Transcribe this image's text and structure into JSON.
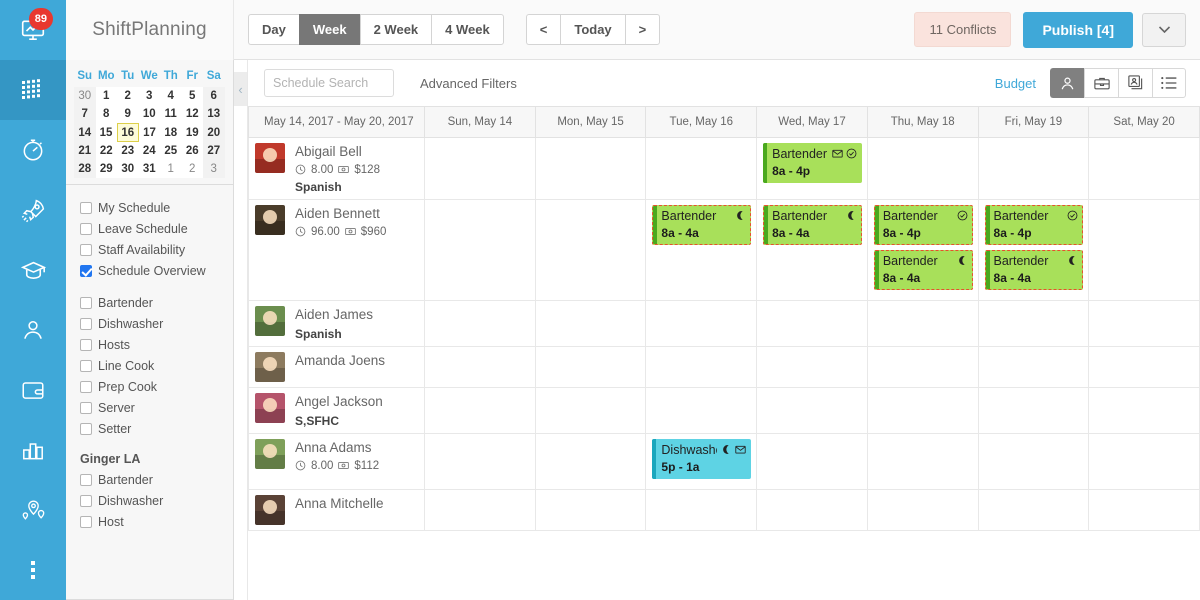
{
  "app": {
    "brand": "ShiftPlanning",
    "notification_badge": "89",
    "accent_blue": "#3fa8d8",
    "shift_green": "#a8e05a",
    "shift_green_bar": "#4aa81e",
    "shift_blue": "#5ed3e4",
    "conflict_border": "#e8502f",
    "today_highlight": "#fcfcec"
  },
  "rail": {
    "items": [
      {
        "icon": "presentation-chart-icon",
        "name": "notifications"
      },
      {
        "icon": "schedule-grid-icon",
        "name": "schedule",
        "active": true
      },
      {
        "icon": "stopwatch-icon",
        "name": "timeclock"
      },
      {
        "icon": "rocket-icon",
        "name": "launch"
      },
      {
        "icon": "graduation-cap-icon",
        "name": "training"
      },
      {
        "icon": "person-icon",
        "name": "staff"
      },
      {
        "icon": "wallet-icon",
        "name": "payroll"
      },
      {
        "icon": "bar-chart-icon",
        "name": "reports"
      },
      {
        "icon": "map-pins-icon",
        "name": "locations"
      },
      {
        "icon": "more-vertical-icon",
        "name": "more"
      }
    ]
  },
  "toolbar": {
    "views": [
      {
        "label": "Day",
        "selected": false
      },
      {
        "label": "Week",
        "selected": true
      },
      {
        "label": "2 Week",
        "selected": false
      },
      {
        "label": "4 Week",
        "selected": false
      }
    ],
    "nav": [
      {
        "label": "<",
        "name": "prev"
      },
      {
        "label": "Today",
        "name": "today"
      },
      {
        "label": ">",
        "name": "next"
      }
    ],
    "conflicts_label": "11 Conflicts",
    "publish_label": "Publish [4]",
    "dropdown_label": "▾"
  },
  "subbar": {
    "search_placeholder": "Schedule Search",
    "search_value": "",
    "advanced_filters": "Advanced Filters",
    "budget": "Budget",
    "view_toggles": [
      {
        "icon": "person-icon",
        "name": "view-by-employee",
        "selected": true
      },
      {
        "icon": "briefcase-icon",
        "name": "view-by-position",
        "selected": false
      },
      {
        "icon": "cards-icon",
        "name": "view-cards",
        "selected": false
      },
      {
        "icon": "list-icon",
        "name": "view-list",
        "selected": false
      }
    ],
    "collapse_handle": "‹"
  },
  "calendar": {
    "weekday_headers": [
      "Su",
      "Mo",
      "Tu",
      "We",
      "Th",
      "Fr",
      "Sa"
    ],
    "weeks": [
      [
        {
          "d": "30",
          "dim": true
        },
        {
          "d": "1"
        },
        {
          "d": "2"
        },
        {
          "d": "3"
        },
        {
          "d": "4"
        },
        {
          "d": "5"
        },
        {
          "d": "6"
        }
      ],
      [
        {
          "d": "7"
        },
        {
          "d": "8"
        },
        {
          "d": "9"
        },
        {
          "d": "10"
        },
        {
          "d": "11"
        },
        {
          "d": "12"
        },
        {
          "d": "13"
        }
      ],
      [
        {
          "d": "14",
          "sel": true
        },
        {
          "d": "15",
          "sel": true
        },
        {
          "d": "16",
          "sel": true,
          "today": true
        },
        {
          "d": "17",
          "sel": true
        },
        {
          "d": "18",
          "sel": true
        },
        {
          "d": "19",
          "sel": true
        },
        {
          "d": "20",
          "sel": true
        }
      ],
      [
        {
          "d": "21"
        },
        {
          "d": "22"
        },
        {
          "d": "23"
        },
        {
          "d": "24"
        },
        {
          "d": "25"
        },
        {
          "d": "26"
        },
        {
          "d": "27"
        }
      ],
      [
        {
          "d": "28"
        },
        {
          "d": "29"
        },
        {
          "d": "30"
        },
        {
          "d": "31"
        },
        {
          "d": "1",
          "dim": true
        },
        {
          "d": "2",
          "dim": true
        },
        {
          "d": "3",
          "dim": true
        }
      ]
    ]
  },
  "filters": {
    "schedule_types": [
      {
        "label": "My Schedule",
        "checked": false
      },
      {
        "label": "Leave Schedule",
        "checked": false
      },
      {
        "label": "Staff Availability",
        "checked": false
      },
      {
        "label": "Schedule Overview",
        "checked": true
      }
    ],
    "positions": [
      {
        "label": "Bartender",
        "checked": false
      },
      {
        "label": "Dishwasher",
        "checked": false
      },
      {
        "label": "Hosts",
        "checked": false
      },
      {
        "label": "Line Cook",
        "checked": false
      },
      {
        "label": "Prep Cook",
        "checked": false
      },
      {
        "label": "Server",
        "checked": false
      },
      {
        "label": "Setter",
        "checked": false
      }
    ],
    "group_title": "Ginger LA",
    "group_positions": [
      {
        "label": "Bartender",
        "checked": false
      },
      {
        "label": "Dishwasher",
        "checked": false
      },
      {
        "label": "Host",
        "checked": false
      }
    ]
  },
  "grid": {
    "week_range": "May 14, 2017 - May 20, 2017",
    "day_columns": [
      {
        "label": "Sun, May 14",
        "today": false
      },
      {
        "label": "Mon, May 15",
        "today": false
      },
      {
        "label": "Tue, May 16",
        "today": true
      },
      {
        "label": "Wed, May 17",
        "today": false
      },
      {
        "label": "Thu, May 18",
        "today": false
      },
      {
        "label": "Fri, May 19",
        "today": false
      },
      {
        "label": "Sat, May 20",
        "today": false
      }
    ],
    "rows": [
      {
        "name": "Abigail Bell",
        "hours": "8.00",
        "wages": "$128",
        "tag": "Spanish",
        "avatar": "#c0392b",
        "shifts": [
          [],
          [],
          [],
          [
            {
              "role": "Bartender",
              "time": "8a - 4p",
              "color": "green",
              "conflict": false,
              "icons": [
                "envelope-icon",
                "clock-check-icon"
              ]
            }
          ],
          [],
          [],
          []
        ]
      },
      {
        "name": "Aiden Bennett",
        "hours": "96.00",
        "wages": "$960",
        "tag": "",
        "avatar": "#4a3c2a",
        "shifts": [
          [],
          [],
          [
            {
              "role": "Bartender",
              "time": "8a - 4a",
              "color": "green",
              "conflict": true,
              "icons": [
                "moon-icon"
              ]
            }
          ],
          [
            {
              "role": "Bartender",
              "time": "8a - 4a",
              "color": "green",
              "conflict": true,
              "icons": [
                "moon-icon"
              ]
            }
          ],
          [
            {
              "role": "Bartender",
              "time": "8a - 4p",
              "color": "green",
              "conflict": true,
              "icons": [
                "clock-check-icon"
              ]
            },
            {
              "role": "Bartender",
              "time": "8a - 4a",
              "color": "green",
              "conflict": true,
              "icons": [
                "moon-icon"
              ]
            }
          ],
          [
            {
              "role": "Bartender",
              "time": "8a - 4p",
              "color": "green",
              "conflict": true,
              "icons": [
                "clock-check-icon"
              ]
            },
            {
              "role": "Bartender",
              "time": "8a - 4a",
              "color": "green",
              "conflict": true,
              "icons": [
                "moon-icon"
              ]
            }
          ],
          []
        ]
      },
      {
        "name": "Aiden James",
        "hours": "",
        "wages": "",
        "tag": "Spanish",
        "avatar": "#6b8e4e",
        "shifts": [
          [],
          [],
          [],
          [],
          [],
          [],
          []
        ]
      },
      {
        "name": "Amanda Joens",
        "hours": "",
        "wages": "",
        "tag": "",
        "avatar": "#8d7b5f",
        "shifts": [
          [],
          [],
          [],
          [],
          [],
          [],
          []
        ]
      },
      {
        "name": "Angel Jackson",
        "hours": "",
        "wages": "",
        "tag": "S,SFHC",
        "avatar": "#b5546b",
        "shifts": [
          [],
          [],
          [],
          [],
          [],
          [],
          []
        ]
      },
      {
        "name": "Anna Adams",
        "hours": "8.00",
        "wages": "$112",
        "tag": "",
        "avatar": "#7fa05a",
        "shifts": [
          [],
          [],
          [
            {
              "role": "Dishwasher",
              "time": "5p - 1a",
              "color": "blue",
              "conflict": false,
              "icons": [
                "moon-icon",
                "envelope-icon"
              ]
            }
          ],
          [],
          [],
          [],
          []
        ]
      },
      {
        "name": "Anna Mitchelle",
        "hours": "",
        "wages": "",
        "tag": "",
        "avatar": "#5a4236",
        "shifts": [
          [],
          [],
          [],
          [],
          [],
          [],
          []
        ]
      }
    ]
  }
}
